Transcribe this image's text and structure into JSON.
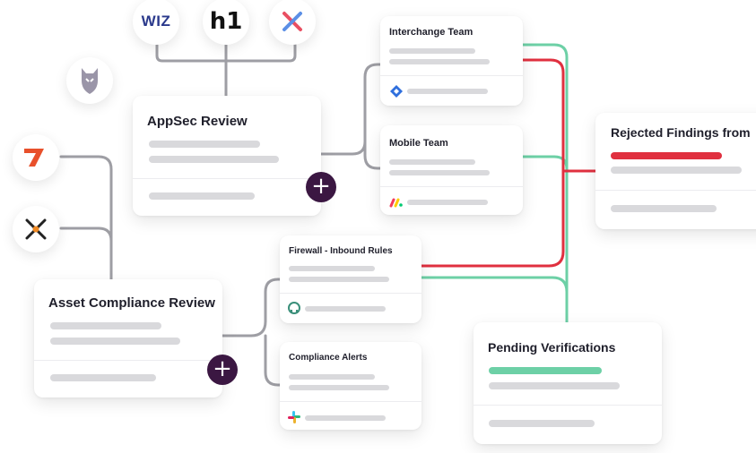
{
  "integrations": {
    "wiz": {
      "label": "WIZ",
      "color": "#2b3a8c"
    },
    "h1": {
      "label": "h1",
      "color": "#111111"
    },
    "x": {
      "label": "X"
    },
    "shield": {
      "label": ""
    },
    "d7": {
      "label": "7"
    },
    "cross": {
      "label": ""
    }
  },
  "cards": {
    "appsec": {
      "title": "AppSec Review"
    },
    "asset": {
      "title": "Asset Compliance Review"
    },
    "interchange": {
      "title": "Interchange Team"
    },
    "mobile": {
      "title": "Mobile Team"
    },
    "firewall": {
      "title": "Firewall - Inbound Rules"
    },
    "compliance": {
      "title": "Compliance Alerts"
    },
    "rejected": {
      "title": "Rejected Findings from"
    },
    "pending": {
      "title": "Pending Verifications"
    }
  },
  "buttons": {
    "add_label": "+"
  },
  "colors": {
    "reject": "#e0303f",
    "verify": "#6dd0a6",
    "connector": "#9e9ea4",
    "accent": "#3b1742"
  }
}
